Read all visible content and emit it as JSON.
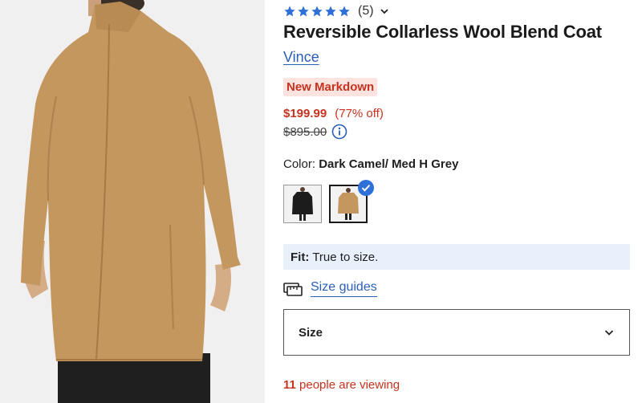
{
  "product": {
    "rating_count": "(5)",
    "stars": 5,
    "title": "Reversible Collarless Wool Blend Coat",
    "brand": "Vince",
    "badge": "New Markdown",
    "price": "$199.99",
    "discount": "(77% off)",
    "original_price": "$895.00"
  },
  "color": {
    "label": "Color:",
    "selected": "Dark Camel/ Med H Grey",
    "swatches": [
      "black-coat-swatch",
      "camel-coat-swatch"
    ]
  },
  "fit": {
    "label": "Fit:",
    "value": "True to size."
  },
  "size_guides": {
    "label": "Size guides"
  },
  "size": {
    "label": "Size"
  },
  "viewing": {
    "count": "11",
    "text": " people are viewing"
  },
  "colors": {
    "accent_red": "#c6331f",
    "link_blue": "#2a5fb8",
    "star_blue": "#2e6fd8",
    "fit_bg": "#e8f0fb"
  }
}
